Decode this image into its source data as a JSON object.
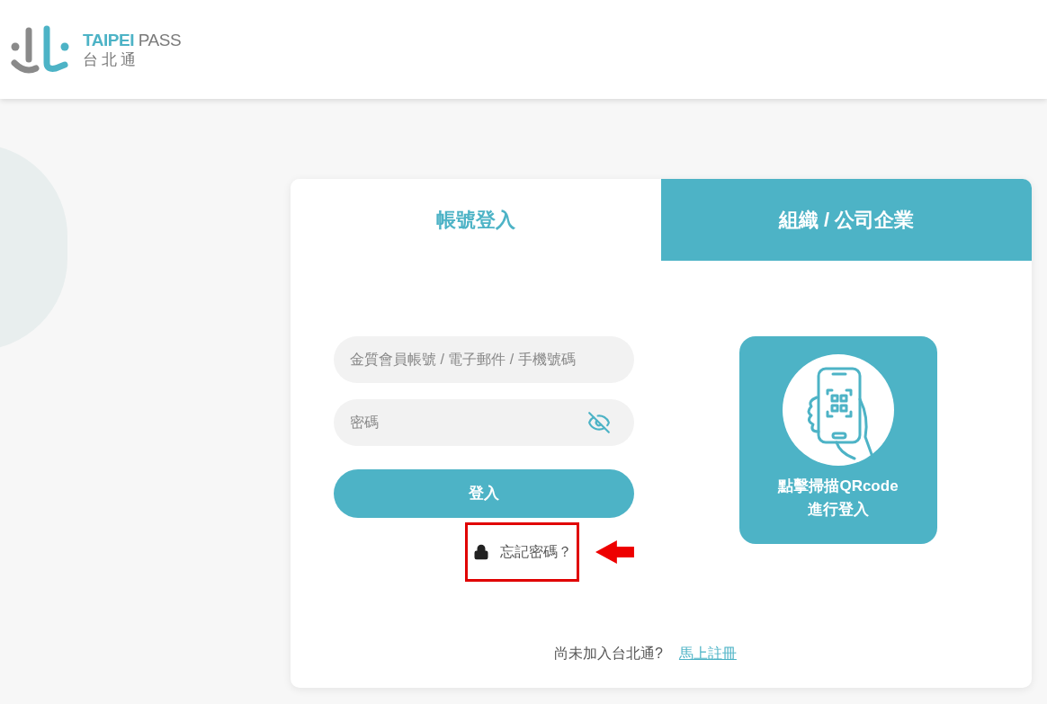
{
  "header": {
    "logo": {
      "title": "TAIPEI PASS",
      "subtitle": "台北通"
    }
  },
  "tabs": [
    {
      "label": "帳號登入",
      "selected": true
    },
    {
      "label": "組織 / 公司企業",
      "selected": false
    }
  ],
  "login_form": {
    "account_field": {
      "placeholder": "金質會員帳號 / 電子郵件 / 手機號碼"
    },
    "password_field": {
      "placeholder": "密碼",
      "password_hidden": true
    },
    "login_button": "登入",
    "forgot_password": {
      "label": "忘記密碼？",
      "highlighted": true
    }
  },
  "qr_login": {
    "lines": [
      "點擊掃描QRcode",
      "進行登入"
    ]
  },
  "register": {
    "prompt": "尚未加入台北通?",
    "link": "馬上註冊"
  }
}
